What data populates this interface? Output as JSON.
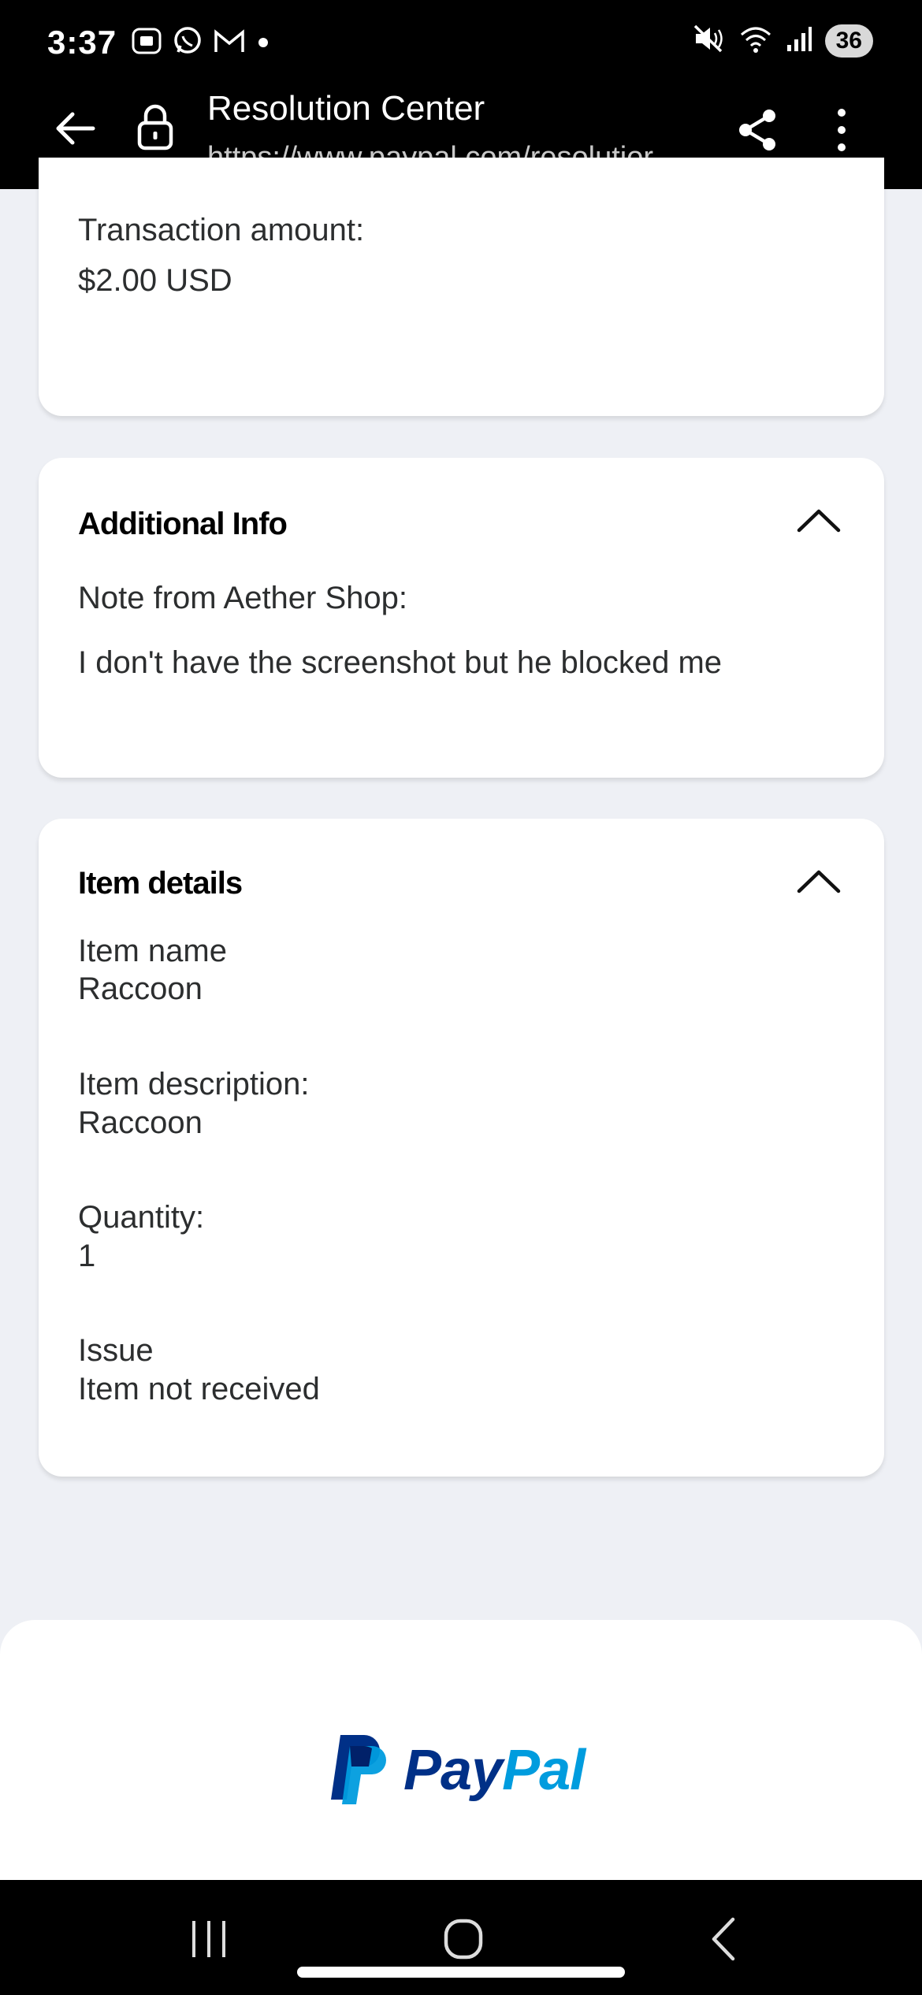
{
  "status_bar": {
    "time": "3:37",
    "battery": "36",
    "left_icons": [
      "screenshot-icon",
      "whatsapp-icon",
      "gmail-icon",
      "dot-icon"
    ],
    "right_icons": [
      "mute-icon",
      "wifi-icon",
      "signal-icon"
    ]
  },
  "browser": {
    "title": "Resolution Center",
    "url": "https://www.paypal.com/resolutior"
  },
  "transaction": {
    "amount_label": "Transaction amount:",
    "amount_value": "$2.00 USD"
  },
  "additional_info": {
    "heading": "Additional Info",
    "note_label": "Note from Aether Shop:",
    "note_text": "I don't have the screenshot but he blocked me"
  },
  "item_details": {
    "heading": "Item details",
    "name_label": "Item name",
    "name_value": "Raccoon",
    "description_label": "Item description:",
    "description_value": "Raccoon",
    "quantity_label": "Quantity:",
    "quantity_value": "1",
    "issue_label": "Issue",
    "issue_value": "Item not received"
  },
  "footer": {
    "logo_pay": "Pay",
    "logo_pal": "Pal"
  },
  "colors": {
    "paypal_dark_blue": "#003087",
    "paypal_light_blue": "#009cde",
    "page_background": "#eef0f5"
  }
}
